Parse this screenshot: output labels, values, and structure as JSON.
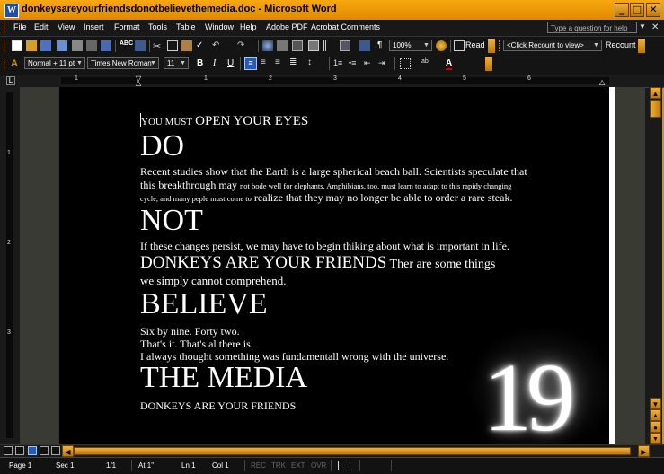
{
  "window": {
    "title": "donkeysareyourfriendsdonotbelievethemedia.doc - Microsoft Word",
    "app_icon_letter": "W",
    "minimize": "_",
    "maximize": "□",
    "close": "✕"
  },
  "menubar": {
    "items": [
      "File",
      "Edit",
      "View",
      "Insert",
      "Format",
      "Tools",
      "Table",
      "Window",
      "Help",
      "Adobe PDF",
      "Acrobat Comments"
    ],
    "help_placeholder": "Type a question for help",
    "dropdown": "▼",
    "close_doc": "✕"
  },
  "standard_toolbar": {
    "zoom": "100%",
    "read_label": "Read",
    "recount_combo": "<Click Recount to view>",
    "recount_label": "Recount",
    "paragraph_mark": "¶"
  },
  "formatting_toolbar": {
    "style": "Normal + 11 pt",
    "font": "Times New Roman",
    "size": "11",
    "bold": "B",
    "italic": "I",
    "underline": "U",
    "font_color_glyph": "A"
  },
  "ruler": {
    "tab_selector": "L",
    "numbers": [
      "1",
      "1",
      "2",
      "3",
      "4",
      "5",
      "6"
    ]
  },
  "vertical_ruler": {
    "numbers": [
      "1",
      "2",
      "3"
    ]
  },
  "document": {
    "line1_small": "YOU MUST",
    "line1_large": "OPEN YOUR EYES",
    "h_do": "DO",
    "p1_line1": "Recent studies show that the Earth is a large spherical beach ball. Scientists speculate that",
    "p1_line2_a": "this breakthrough may",
    "p1_line2_b": "not bode well for elephants. Amphibians, too, must learn to adapt to this rapidy changing",
    "p1_line3_a": "cycle, and many peple must come to",
    "p1_line3_b": "realize that they may no longer be able to order a rare steak.",
    "h_not": "NOT",
    "p2_line1": "If these changes persist, we may have to begin thiking about what is important in life.",
    "p2_line2_big": "DONKEYS ARE YOUR FRIENDS",
    "p2_line2_rest": "Ther are some things",
    "p2_line3": "we simply cannot comprehend.",
    "h_believe": "BELIEVE",
    "p3_line1": "Six by nine. Forty two.",
    "p3_line2": "That's it. That's al there is.",
    "p3_line3": "I always thought something was fundamentall wrong with the universe.",
    "h_media": "THE MEDIA",
    "closing": "DONKEYS ARE YOUR FRIENDS",
    "art_number": "19"
  },
  "statusbar": {
    "page": "Page  1",
    "sec": "Sec  1",
    "page_of": "1/1",
    "at": "At  1\"",
    "ln": "Ln  1",
    "col": "Col  1",
    "rec": "REC",
    "trk": "TRK",
    "ext": "EXT",
    "ovr": "OVR"
  },
  "colors": {
    "accent": "#d89000",
    "titlebar": "#f0a000",
    "background": "#000000",
    "text": "#ffffff"
  }
}
